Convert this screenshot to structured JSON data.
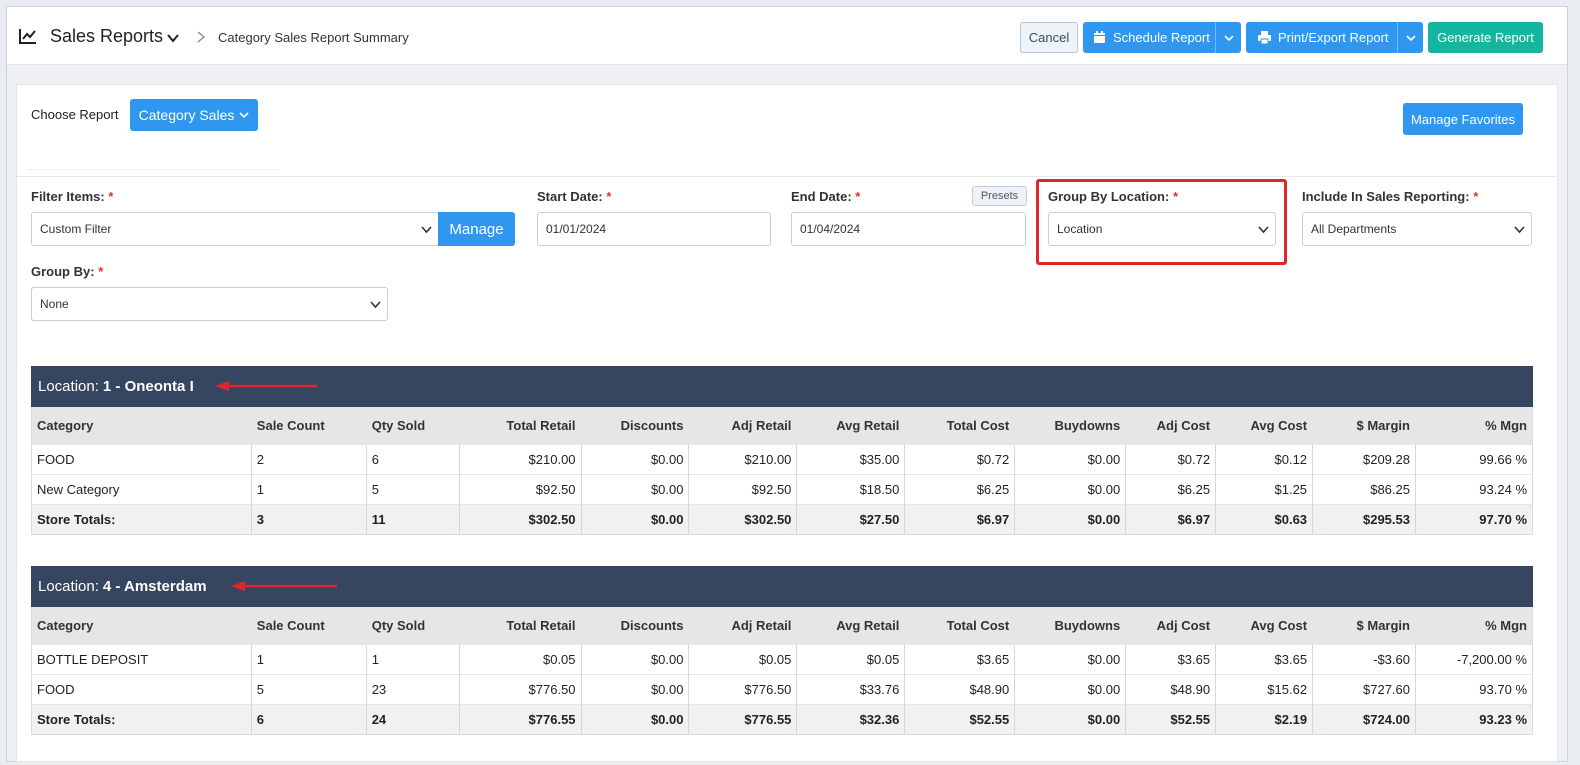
{
  "header": {
    "title": "Sales Reports",
    "breadcrumb": "Category Sales Report Summary",
    "cancel_label": "Cancel",
    "schedule_label": "Schedule Report",
    "print_label": "Print/Export Report",
    "generate_label": "Generate Report"
  },
  "choose": {
    "label": "Choose Report",
    "report_button": "Category Sales",
    "manage_favorites": "Manage Favorites"
  },
  "filters": {
    "filter_items": {
      "label": "Filter Items:",
      "value": "Custom Filter",
      "manage": "Manage"
    },
    "start_date": {
      "label": "Start Date:",
      "value": "01/01/2024"
    },
    "end_date": {
      "label": "End Date:",
      "value": "01/04/2024",
      "presets": "Presets"
    },
    "group_by_location": {
      "label": "Group By Location:",
      "value": "Location"
    },
    "include_sales": {
      "label": "Include In Sales Reporting:",
      "value": "All Departments"
    },
    "group_by": {
      "label": "Group By:",
      "value": "None"
    },
    "required_mark": "*"
  },
  "columns": [
    "Category",
    "Sale Count",
    "Qty Sold",
    "Total Retail",
    "Discounts",
    "Adj Retail",
    "Avg Retail",
    "Total Cost",
    "Buydowns",
    "Adj Cost",
    "Avg Cost",
    "$ Margin",
    "% Mgn"
  ],
  "locations": [
    {
      "prefix": "Location:",
      "name": "1 - Oneonta I",
      "rows": [
        [
          "FOOD",
          "2",
          "6",
          "$210.00",
          "$0.00",
          "$210.00",
          "$35.00",
          "$0.72",
          "$0.00",
          "$0.72",
          "$0.12",
          "$209.28",
          "99.66 %"
        ],
        [
          "New Category",
          "1",
          "5",
          "$92.50",
          "$0.00",
          "$92.50",
          "$18.50",
          "$6.25",
          "$0.00",
          "$6.25",
          "$1.25",
          "$86.25",
          "93.24 %"
        ]
      ],
      "totals": [
        "Store Totals:",
        "3",
        "11",
        "$302.50",
        "$0.00",
        "$302.50",
        "$27.50",
        "$6.97",
        "$0.00",
        "$6.97",
        "$0.63",
        "$295.53",
        "97.70 %"
      ]
    },
    {
      "prefix": "Location:",
      "name": "4 - Amsterdam",
      "rows": [
        [
          "BOTTLE DEPOSIT",
          "1",
          "1",
          "$0.05",
          "$0.00",
          "$0.05",
          "$0.05",
          "$3.65",
          "$0.00",
          "$3.65",
          "$3.65",
          "-$3.60",
          "-7,200.00 %"
        ],
        [
          "FOOD",
          "5",
          "23",
          "$776.50",
          "$0.00",
          "$776.50",
          "$33.76",
          "$48.90",
          "$0.00",
          "$48.90",
          "$15.62",
          "$727.60",
          "93.70 %"
        ]
      ],
      "totals": [
        "Store Totals:",
        "6",
        "24",
        "$776.55",
        "$0.00",
        "$776.55",
        "$32.36",
        "$52.55",
        "$0.00",
        "$52.55",
        "$2.19",
        "$724.00",
        "93.23 %"
      ]
    }
  ],
  "colors": {
    "primary": "#2f97f0",
    "success": "#16b5a0",
    "location_bar": "#364560",
    "highlight": "#e0252c"
  },
  "icons": [
    "chart-line-icon",
    "chevron-down-icon",
    "chevron-right-icon",
    "calendar-icon",
    "printer-icon",
    "arrow-left-icon"
  ]
}
